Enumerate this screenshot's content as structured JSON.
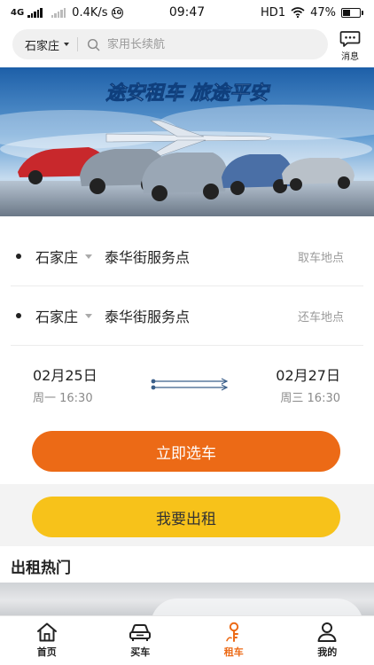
{
  "status_bar": {
    "network": "4G",
    "speed": "0.4K/s",
    "time": "09:47",
    "carrier": "HD1",
    "battery": "47%",
    "battery_level": 0.47
  },
  "search": {
    "city": "石家庄",
    "placeholder": "家用长续航"
  },
  "messages": {
    "label": "消息"
  },
  "banner": {
    "headline": "途安租车  旅途平安"
  },
  "pickup": {
    "city": "石家庄",
    "store": "泰华街服务点",
    "hint": "取车地点"
  },
  "return": {
    "city": "石家庄",
    "store": "泰华街服务点",
    "hint": "还车地点"
  },
  "dates": {
    "start_date": "02月25日",
    "start_time": "周一 16:30",
    "end_date": "02月27日",
    "end_time": "周三 16:30"
  },
  "buttons": {
    "select_car": "立即选车",
    "lease_out": "我要出租"
  },
  "section": {
    "hot_title": "出租热门"
  },
  "tabs": [
    {
      "label": "首页",
      "icon": "home-icon"
    },
    {
      "label": "买车",
      "icon": "car-icon"
    },
    {
      "label": "租车",
      "icon": "key-icon"
    },
    {
      "label": "我的",
      "icon": "profile-icon"
    }
  ],
  "colors": {
    "accent": "#ec6a16",
    "secondary": "#f7c21a"
  }
}
